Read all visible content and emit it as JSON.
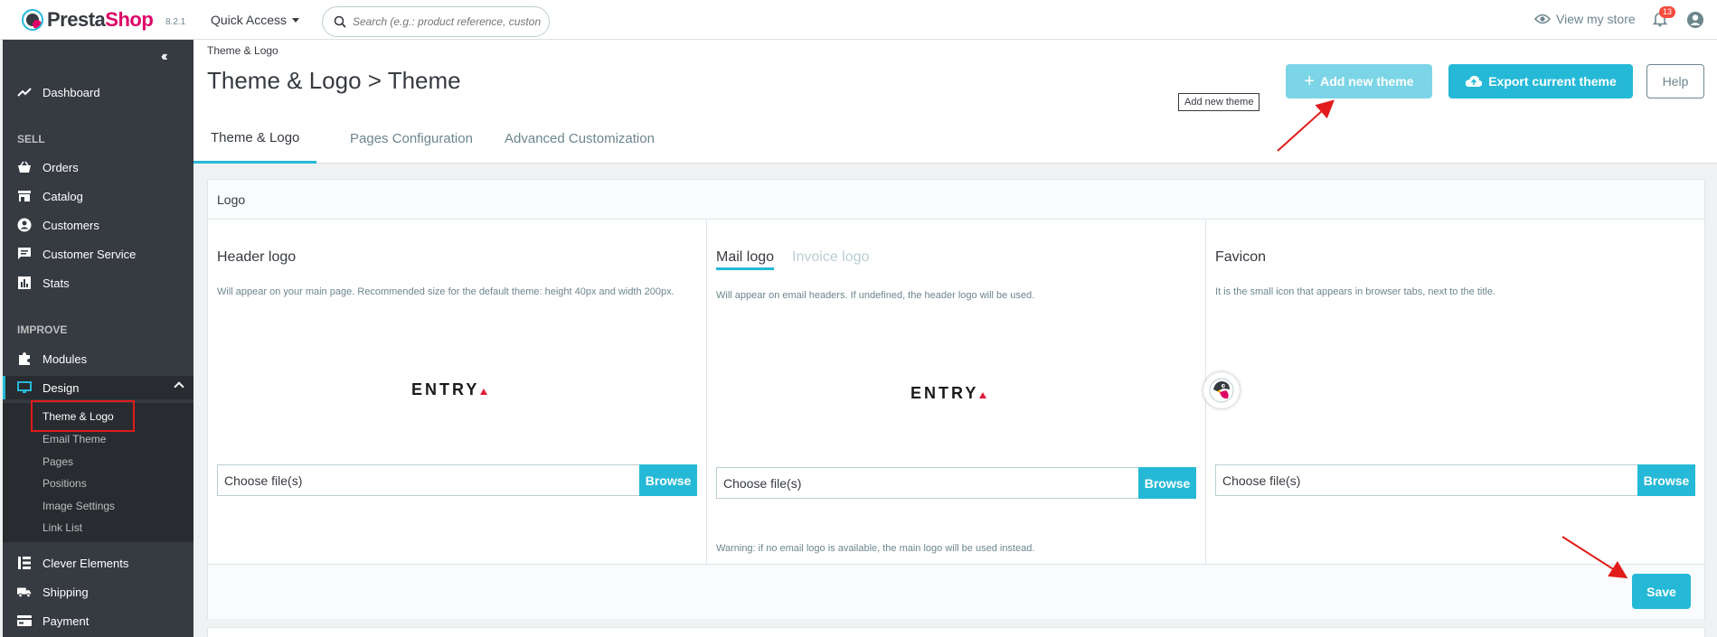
{
  "app": {
    "brand_part1": "Presta",
    "brand_part2": "Shop",
    "version": "8.2.1",
    "quick_access": "Quick Access",
    "search_placeholder": "Search (e.g.: product reference, custon",
    "view_store": "View my store",
    "notifications_count": "13"
  },
  "sidebar": {
    "dashboard": "Dashboard",
    "sell_title": "SELL",
    "orders": "Orders",
    "catalog": "Catalog",
    "customers": "Customers",
    "customer_service": "Customer Service",
    "stats": "Stats",
    "improve_title": "IMPROVE",
    "modules": "Modules",
    "design": "Design",
    "design_sub": {
      "theme_logo": "Theme & Logo",
      "email_theme": "Email Theme",
      "pages": "Pages",
      "positions": "Positions",
      "image_settings": "Image Settings",
      "link_list": "Link List"
    },
    "clever_elements": "Clever Elements",
    "shipping": "Shipping",
    "payment": "Payment"
  },
  "header": {
    "breadcrumb": "Theme & Logo",
    "title": "Theme & Logo > Theme",
    "add_theme": "Add new theme",
    "export_theme": "Export current theme",
    "help": "Help",
    "tooltip": "Add new theme"
  },
  "tabs": {
    "theme_logo": "Theme & Logo",
    "pages_config": "Pages Configuration",
    "advanced": "Advanced Customization"
  },
  "logo_card": {
    "title": "Logo",
    "header_logo": {
      "title": "Header logo",
      "desc": "Will appear on your main page. Recommended size for the default theme: height 40px and width 200px.",
      "image_text": "ENTRY",
      "file_placeholder": "Choose file(s)",
      "browse": "Browse"
    },
    "mail_logo": {
      "tab_mail": "Mail logo",
      "tab_invoice": "Invoice logo",
      "desc": "Will appear on email headers. If undefined, the header logo will be used.",
      "image_text": "ENTRY",
      "file_placeholder": "Choose file(s)",
      "browse": "Browse",
      "warning": "Warning: if no email logo is available, the main logo will be used instead."
    },
    "favicon": {
      "title": "Favicon",
      "desc": "It is the small icon that appears in browser tabs, next to the title.",
      "file_placeholder": "Choose file(s)",
      "browse": "Browse"
    },
    "save": "Save"
  },
  "colors": {
    "accent": "#25b9d7",
    "sidebar": "#363a41",
    "brand_pink": "#df0067",
    "annotation_red": "#e21b1b"
  }
}
